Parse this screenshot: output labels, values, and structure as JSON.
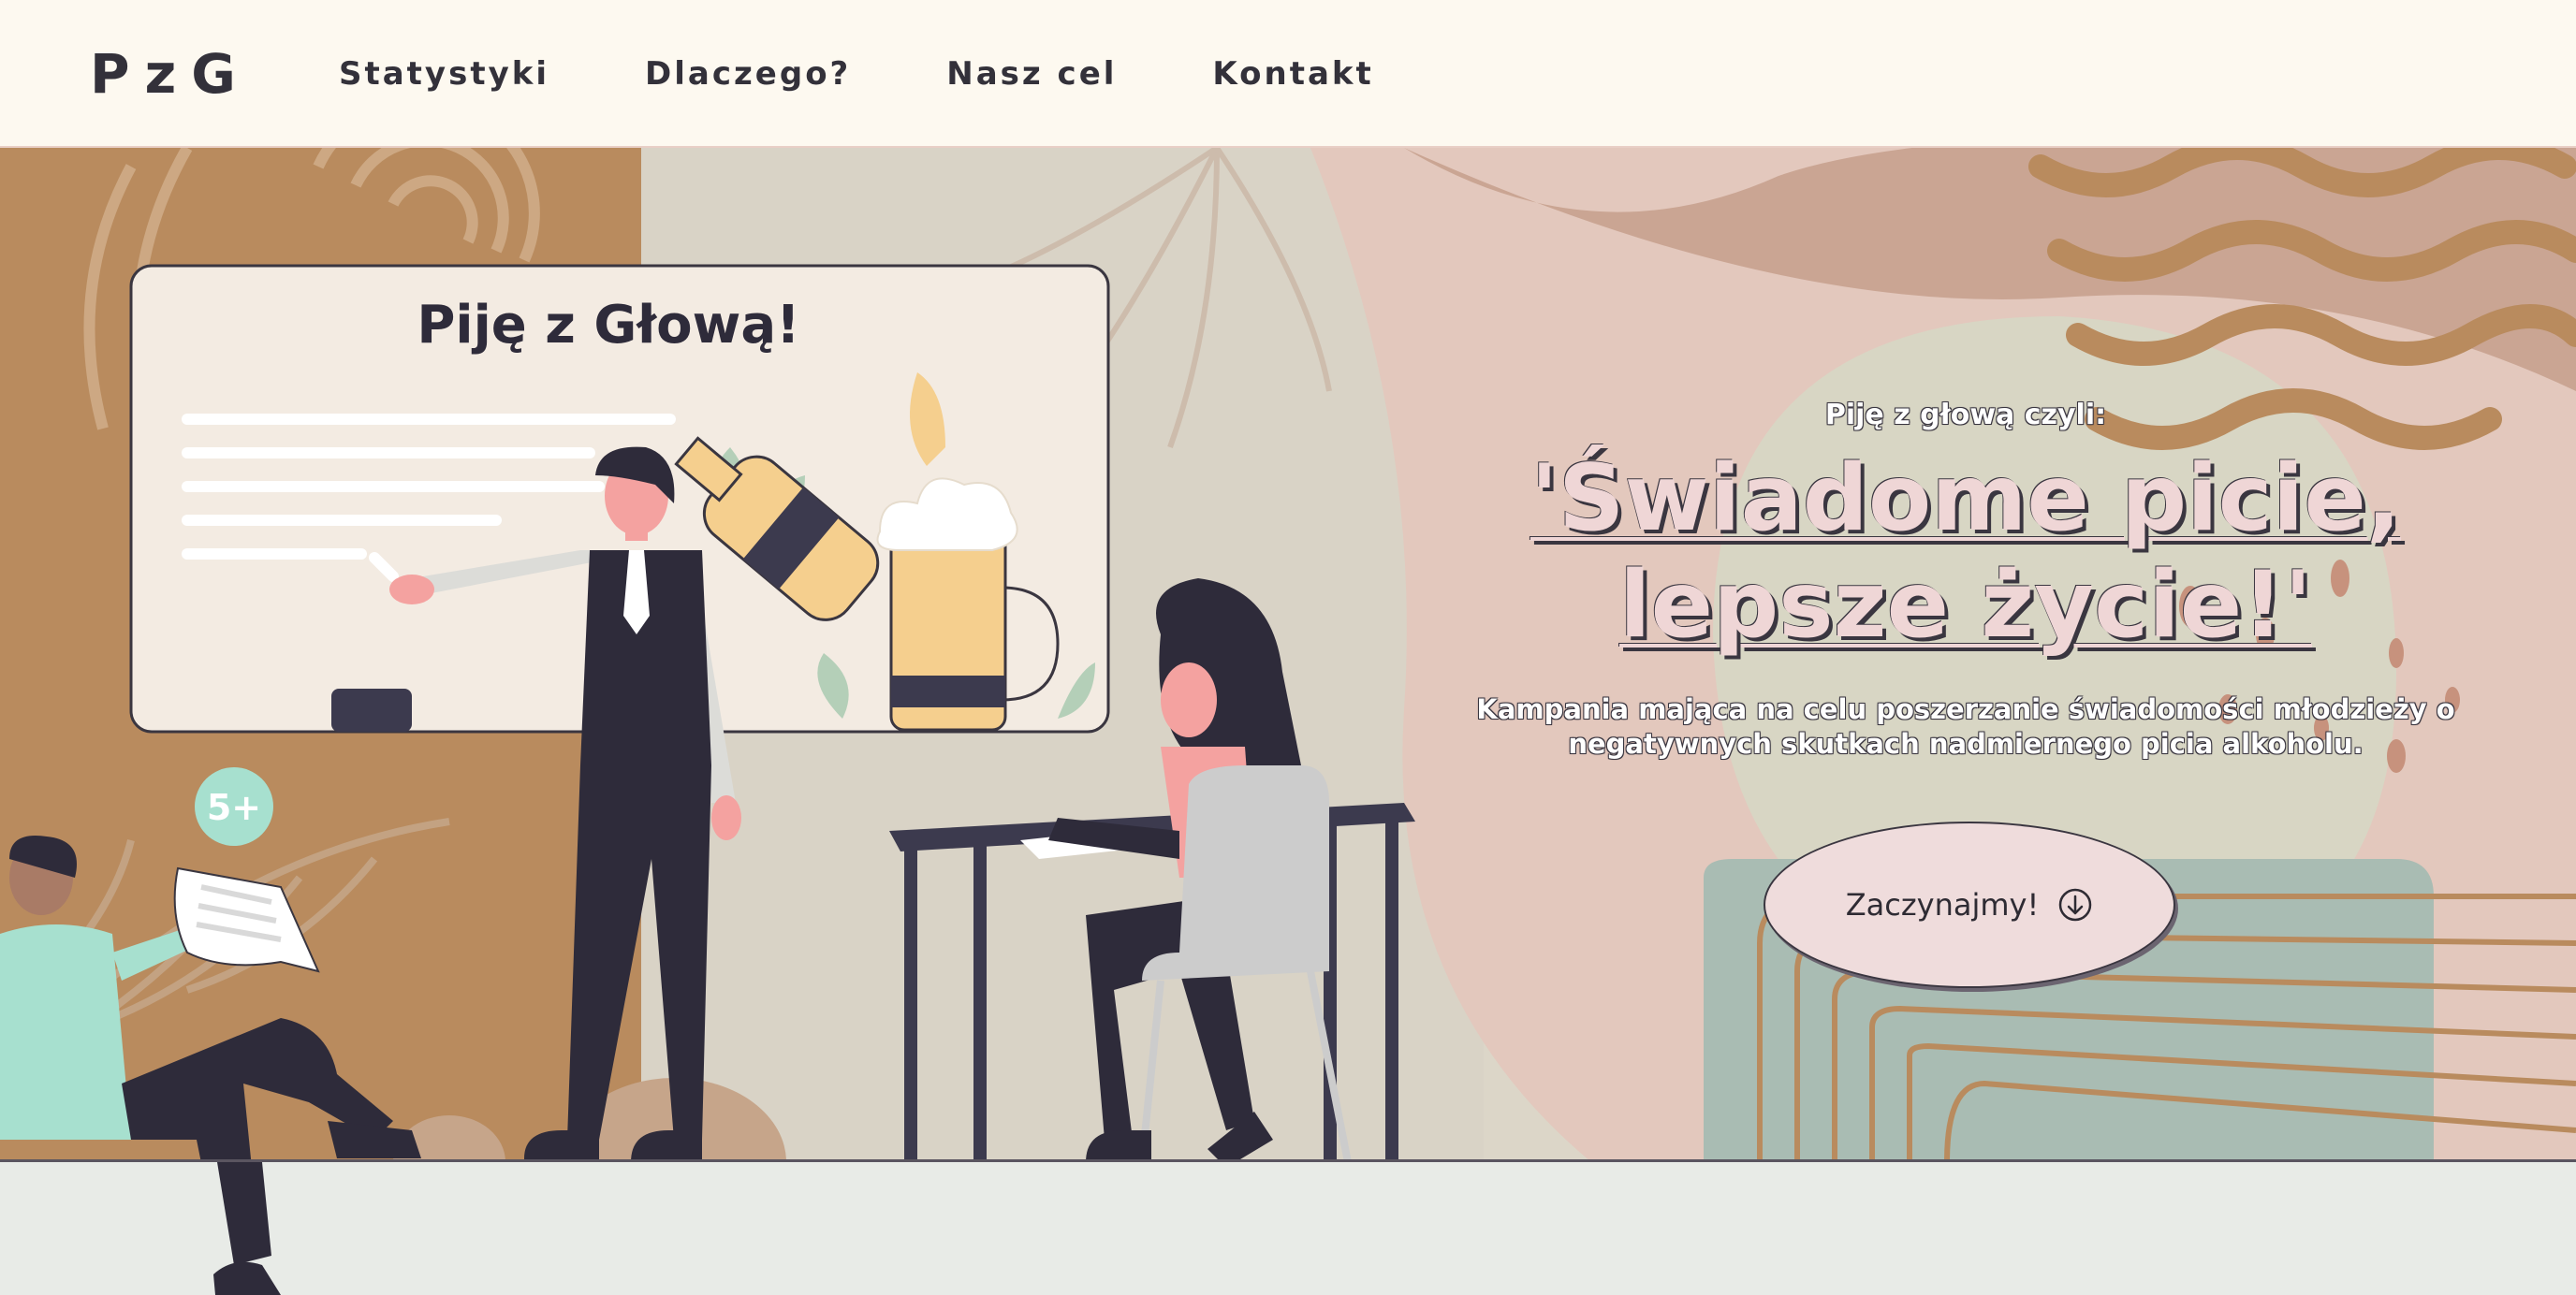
{
  "nav": {
    "logo": "PzG",
    "links": [
      {
        "label": "Statystyki"
      },
      {
        "label": "Dlaczego?"
      },
      {
        "label": "Nasz cel"
      },
      {
        "label": "Kontakt"
      }
    ]
  },
  "illustration": {
    "board_title": "Piję z Głową!",
    "badge": "5+"
  },
  "hero": {
    "pretitle": "Piję z głową czyli:",
    "title_line1": "'Świadome picie,",
    "title_line2": "lepsze życie!'",
    "description_line1": "Kampania mająca na celu poszerzanie świadomości młodzieży o",
    "description_line2": "negatywnych skutkach nadmiernego picia alkoholu.",
    "cta_label": "Zaczynajmy!",
    "cta_icon": "arrow-down-circle-icon"
  },
  "colors": {
    "nav_bg": "#fdf9f0",
    "text_dark": "#33313a",
    "title_pink": "#efd6d6",
    "terracotta": "#b98b5e",
    "sage": "#a7bcb3"
  }
}
